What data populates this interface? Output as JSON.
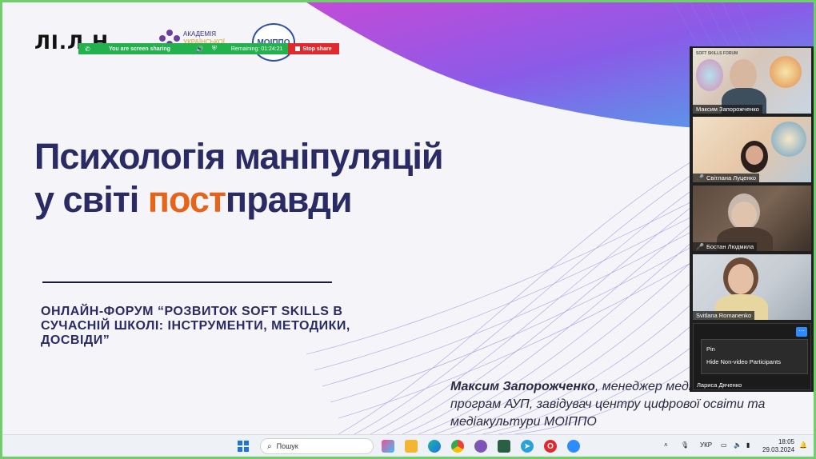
{
  "slide": {
    "logo_main": "ЛІ.Л.Н",
    "logo_aup_line1": "АКАДЕМІЯ",
    "logo_aup_line2": "УКРАЇНСЬКОЇ",
    "logo_moippo": "МОІППО",
    "title_line1": "Психологія маніпуляцій",
    "title_line2_start": "у світі ",
    "title_line2_accent": "пост",
    "title_line2_end": "правди",
    "forum_text": "ОНЛАЙН-ФОРУМ “РОЗВИТОК SOFT SKILLS В СУЧАСНІЙ ШКОЛІ: ІНСТРУМЕНТИ, МЕТОДИКИ, ДОСВІДИ”",
    "speaker_name": "Максим Запорожченко",
    "speaker_role": ", менеджер медіаосвітніх програм АУП, завідувач центру цифрової освіти та медіакультури МОІППО",
    "accent_color": "#e8631a",
    "title_color": "#2a2a64"
  },
  "share_bar": {
    "status": "You are screen sharing",
    "remaining": "Remaining: 01:24:21",
    "stop_label": "Stop share"
  },
  "participants": [
    {
      "name": "Максим Запорожченко",
      "muted": false,
      "tile_caption": "SOFT SKILLS FORUM"
    },
    {
      "name": "Світлана Луценко",
      "muted": true
    },
    {
      "name": "Бостан Людмила",
      "muted": true
    },
    {
      "name": "Svitlana Romanenko",
      "muted": false
    },
    {
      "name": "Лариса Дяченко",
      "muted": false
    }
  ],
  "context_menu": {
    "items": [
      "Pin",
      "Hide Non-video Participants"
    ]
  },
  "taskbar": {
    "search_placeholder": "Пошук",
    "language": "УКР",
    "time": "18:05",
    "date": "29.03.2024"
  }
}
